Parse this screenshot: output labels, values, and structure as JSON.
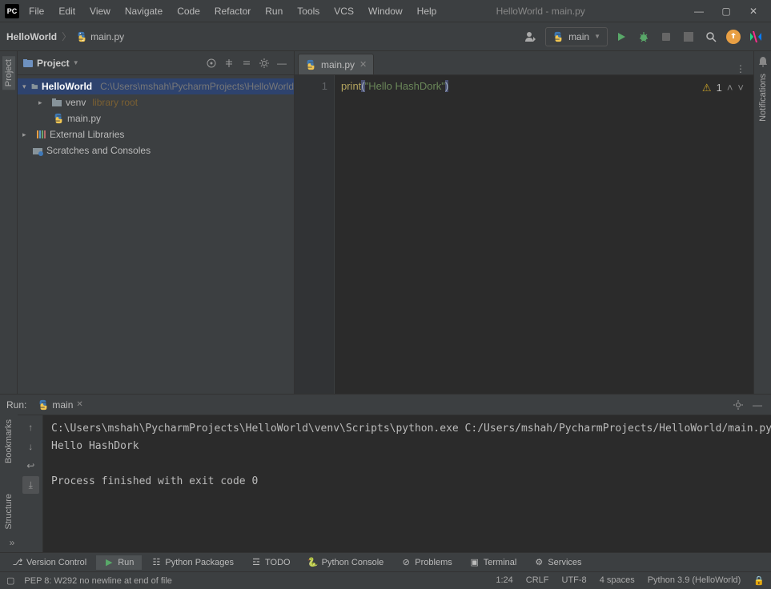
{
  "title": "HelloWorld - main.py",
  "menu": [
    "File",
    "Edit",
    "View",
    "Navigate",
    "Code",
    "Refactor",
    "Run",
    "Tools",
    "VCS",
    "Window",
    "Help"
  ],
  "breadcrumb": {
    "project": "HelloWorld",
    "file": "main.py"
  },
  "run_config": "main",
  "project_panel": {
    "title": "Project",
    "root": {
      "name": "HelloWorld",
      "path": "C:\\Users\\mshah\\PycharmProjects\\HelloWorld"
    },
    "venv": {
      "name": "venv",
      "hint": "library root"
    },
    "mainfile": "main.py",
    "external": "External Libraries",
    "scratches": "Scratches and Consoles"
  },
  "editor": {
    "tab": "main.py",
    "line": "1",
    "code": {
      "fn": "print",
      "str": "\"Hello HashDork\""
    },
    "warn": "1"
  },
  "run": {
    "label": "Run:",
    "conf": "main",
    "output": "C:\\Users\\mshah\\PycharmProjects\\HelloWorld\\venv\\Scripts\\python.exe C:/Users/mshah/PycharmProjects/HelloWorld/main.py\nHello HashDork\n\nProcess finished with exit code 0"
  },
  "bottom_tabs": {
    "vcs": "Version Control",
    "run": "Run",
    "pypkg": "Python Packages",
    "todo": "TODO",
    "pyconsole": "Python Console",
    "problems": "Problems",
    "terminal": "Terminal",
    "services": "Services"
  },
  "status": {
    "msg": "PEP 8: W292 no newline at end of file",
    "pos": "1:24",
    "eol": "CRLF",
    "enc": "UTF-8",
    "indent": "4 spaces",
    "interp": "Python 3.9 (HelloWorld)"
  },
  "side_tabs": {
    "project": "Project",
    "bookmarks": "Bookmarks",
    "structure": "Structure",
    "notifications": "Notifications"
  }
}
